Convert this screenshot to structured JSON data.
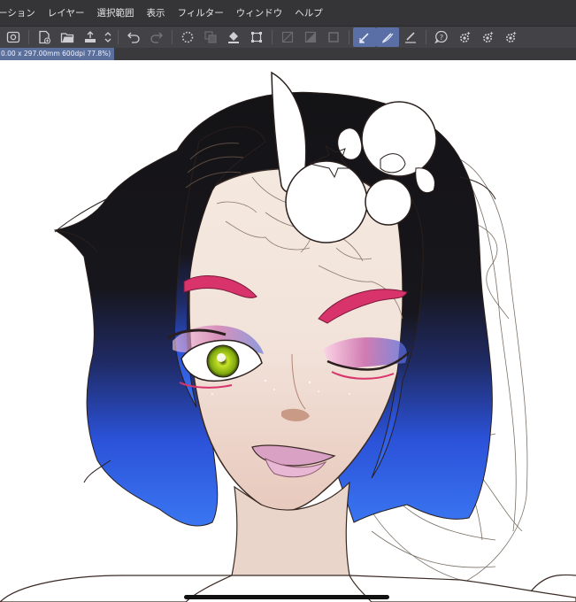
{
  "menu": [
    {
      "label": "ーション"
    },
    {
      "label": "レイヤー"
    },
    {
      "label": "選択範囲"
    },
    {
      "label": "表示"
    },
    {
      "label": "フィルター"
    },
    {
      "label": "ウィンドウ"
    },
    {
      "label": "ヘルプ"
    }
  ],
  "document": {
    "tab_label": "0.00 x 297.00mm 600dpi 77.8%)"
  },
  "colors": {
    "menubar_bg": "#353538",
    "toolbar_bg": "#434347",
    "active_tool": "#5a6fa6",
    "doc_tab": "#5b6f9c",
    "canvas_bg": "#ffffff"
  },
  "toolbar_icons": [
    "eye-icon",
    "new-document-icon",
    "open-folder-icon",
    "save-upload-icon",
    "stepper-icon",
    "undo-icon",
    "redo-icon",
    "loading-icon",
    "copy-layer-icon",
    "fill-icon",
    "transform-icon",
    "clear-selection-icon",
    "mask-icon",
    "square-icon",
    "pen-icon",
    "pen-curve-icon",
    "ruler-pen-icon",
    "help-icon",
    "gear-sparkle-icon"
  ]
}
